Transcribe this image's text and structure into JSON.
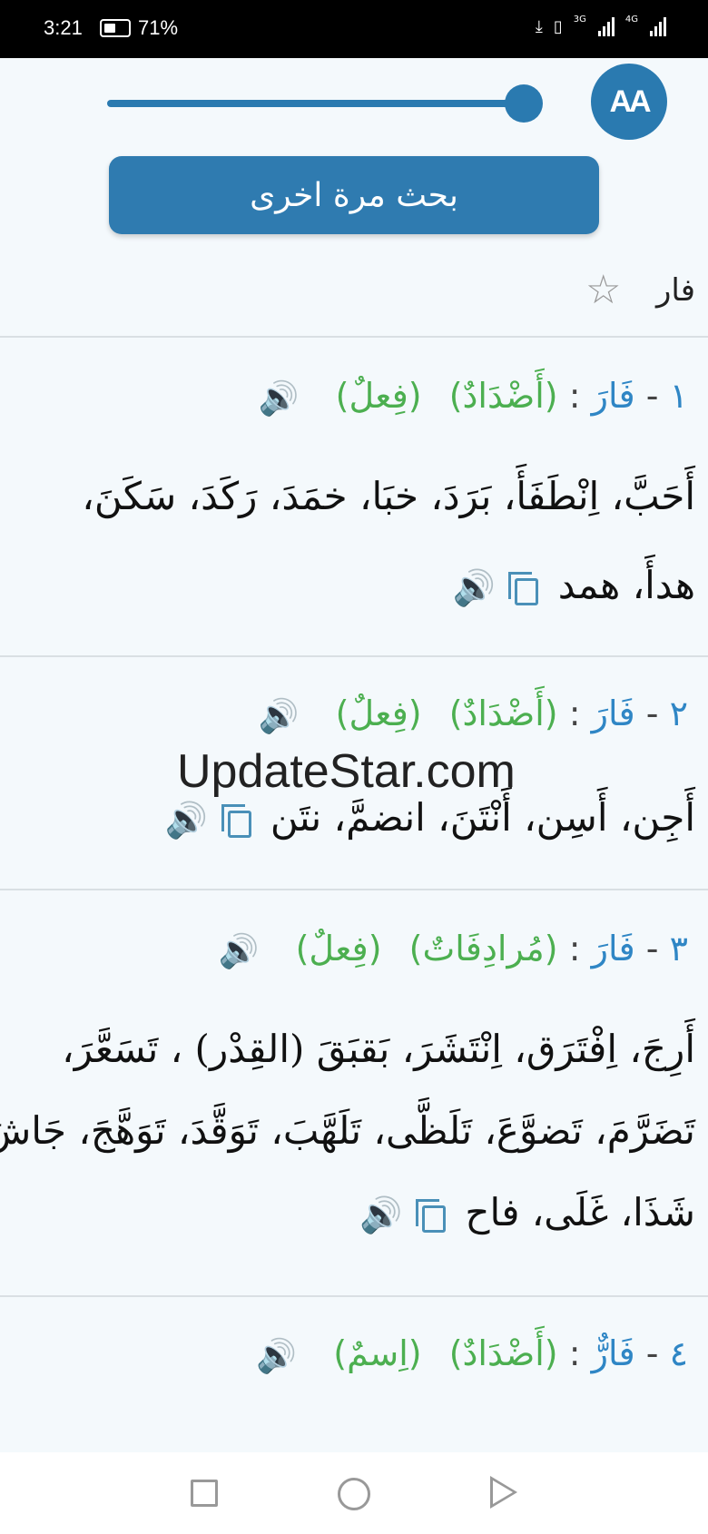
{
  "status": {
    "time": "3:21",
    "battery": "71%",
    "net1": "3G",
    "net2": "4G"
  },
  "toolbar": {
    "aa_label": "AA",
    "search_again": "بحث مرة اخرى"
  },
  "word": {
    "title": "فار"
  },
  "entries": [
    {
      "number": "١",
      "word": "فَارَ",
      "sep": ":",
      "tag1": "(أَضْدَادٌ)",
      "tag2": "(فِعلٌ)",
      "lines": [
        "أَحَبَّ، اِنْطَفَأَ، بَرَدَ، خبَا، خمَدَ، رَكَدَ، سَكَنَ،",
        "هدأَ، همد"
      ]
    },
    {
      "number": "٢",
      "word": "فَارَ",
      "sep": ":",
      "tag1": "(أَضْدَادٌ)",
      "tag2": "(فِعلٌ)",
      "lines": [
        "أَجِن، أَسِن، أَنْتَنَ، انضمَّ، نتَن"
      ]
    },
    {
      "number": "٣",
      "word": "فَارَ",
      "sep": ":",
      "tag1": "(مُرادِفَاتٌ)",
      "tag2": "(فِعلٌ)",
      "lines": [
        "أَرِجَ، اِفْتَرَق، اِنْتَشَرَ، بَقبَقَ (القِدْر) ، تَسَعَّرَ،",
        "تَضَرَّمَ، تَضوَّعَ، تَلَظَّى، تَلَهَّبَ، تَوَقَّدَ، تَوَهَّجَ، جَاشَ،",
        "شَذَا، غَلَى، فاح"
      ]
    },
    {
      "number": "٤",
      "word": "فَارٌّ",
      "sep": ":",
      "tag1": "(أَضْدَادٌ)",
      "tag2": "(اِسمٌ)",
      "lines": []
    }
  ],
  "watermark": "UpdateStar.com",
  "icons": [
    "aa-icon",
    "star-icon",
    "speaker-icon",
    "copy-icon",
    "recents-icon",
    "home-icon",
    "back-icon"
  ]
}
